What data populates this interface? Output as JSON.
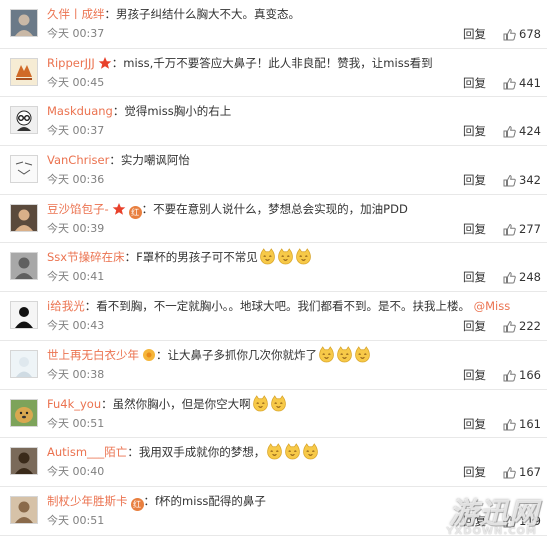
{
  "ui": {
    "reply_label": "回复",
    "accent_color": "#eb7350",
    "separator": "："
  },
  "comments": [
    {
      "user": "久伴丨成绊",
      "text": "男孩子纠结什么胸大不大。真变态。",
      "time": "今天 00:37",
      "likes": "678",
      "avatar_icon": "avatar-photo-icon"
    },
    {
      "user": "RipperJJJ",
      "text": "miss,千万不要答应大鼻子！此人非良配！赞我，让miss看到",
      "time": "今天 00:45",
      "likes": "441",
      "avatar_icon": "avatar-logo-icon",
      "badge": "star-badge-icon"
    },
    {
      "user": "Maskduang",
      "text": "觉得miss胸小的右上",
      "time": "今天 00:37",
      "likes": "424",
      "avatar_icon": "avatar-glasses-icon"
    },
    {
      "user": "VanChriser",
      "text": "实力嘲讽阿怡",
      "time": "今天 00:36",
      "likes": "342",
      "avatar_icon": "avatar-sketch-icon"
    },
    {
      "user": "豆沙馅包子-",
      "text": "不要在意别人说什么，梦想总会实现的，加油PDD",
      "time": "今天 00:39",
      "likes": "277",
      "avatar_icon": "avatar-photo-icon",
      "badge": "star-badge-icon",
      "badge2_text": "红"
    },
    {
      "user": "Ssx节操碎在床",
      "text": "F罩杯的男孩子可不常见",
      "time": "今天 00:41",
      "likes": "248",
      "avatar_icon": "avatar-photo-icon",
      "emoji_count": 3
    },
    {
      "user": "i给我光",
      "text": "看不到胸，不一定就胸小。。地球大吧。我们都看不到。是不。扶我上楼。",
      "mention": "@Miss",
      "time": "今天 00:43",
      "likes": "222",
      "avatar_icon": "avatar-dark-icon"
    },
    {
      "user": "世上再无白衣少年",
      "text": "让大鼻子多抓你几次你就炸了",
      "time": "今天 00:38",
      "likes": "166",
      "avatar_icon": "avatar-light-icon",
      "badge": "flower-badge-icon",
      "emoji_count": 3
    },
    {
      "user": "Fu4k_you",
      "text": "虽然你胸小，但是你空大啊",
      "time": "今天 00:51",
      "likes": "161",
      "avatar_icon": "avatar-dog-icon",
      "emoji_count": 2
    },
    {
      "user": "Autism___陌亡",
      "text": "我用双手成就你的梦想，",
      "time": "今天 00:40",
      "likes": "167",
      "avatar_icon": "avatar-photo-icon",
      "emoji_count": 3
    },
    {
      "user": "制杖少年胜斯卡",
      "text": "f杯的miss配得的鼻子",
      "time": "今天 00:51",
      "likes": "119",
      "avatar_icon": "avatar-photo-icon",
      "badge2_text": "红"
    }
  ],
  "watermark": {
    "main": "游迅网",
    "sub": "YXDOWN.COM"
  }
}
